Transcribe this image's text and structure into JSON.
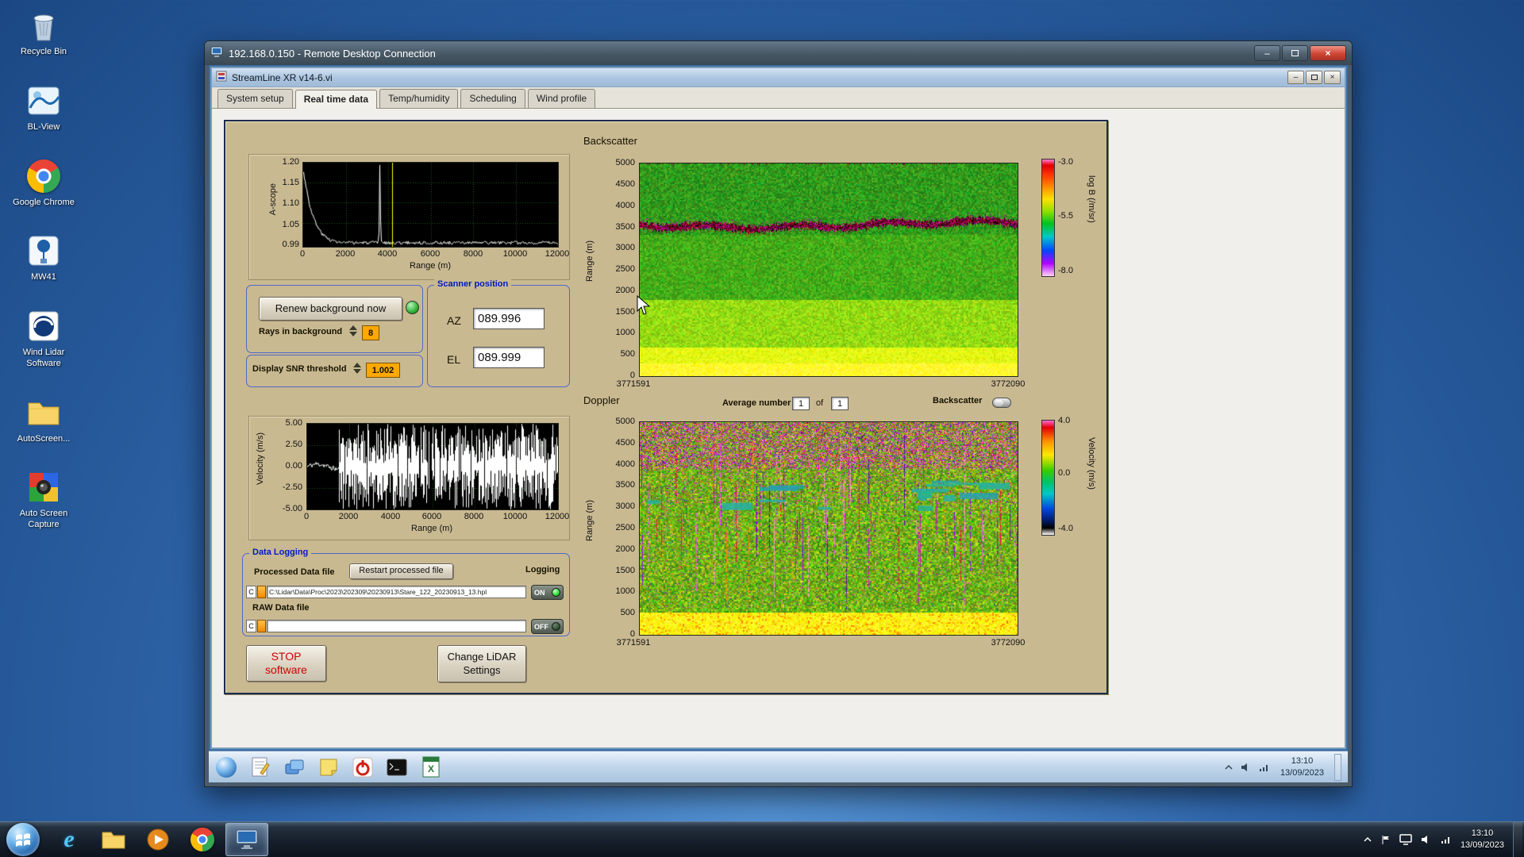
{
  "desktop": {
    "icons": [
      {
        "name": "recycle-bin",
        "label": "Recycle Bin"
      },
      {
        "name": "bl-view",
        "label": "BL-View"
      },
      {
        "name": "google-chrome",
        "label": "Google Chrome"
      },
      {
        "name": "mw41",
        "label": "MW41"
      },
      {
        "name": "wind-lidar-software",
        "label": "Wind Lidar Software"
      },
      {
        "name": "autoscreen-folder",
        "label": "AutoScreen..."
      },
      {
        "name": "auto-screen-capture",
        "label": "Auto Screen Capture"
      }
    ]
  },
  "rdp_window": {
    "title": "192.168.0.150 - Remote Desktop Connection"
  },
  "app_window": {
    "title": "StreamLine XR v14-6.vi",
    "tabs": [
      {
        "label": "System setup"
      },
      {
        "label": "Real time data"
      },
      {
        "label": "Temp/humidity"
      },
      {
        "label": "Scheduling"
      },
      {
        "label": "Wind profile"
      }
    ],
    "active_tab": "Real time data"
  },
  "panel": {
    "ascope": {
      "ylabel": "A-scope",
      "xlabel": "Range (m)",
      "yticks": [
        "1.20",
        "1.15",
        "1.10",
        "1.05",
        "0.99"
      ],
      "xticks": [
        "0",
        "2000",
        "4000",
        "6000",
        "8000",
        "10000",
        "12000"
      ]
    },
    "background_controls": {
      "renew_button": "Renew background now",
      "rays_label": "Rays in background",
      "rays_value": "8",
      "snr_label": "Display SNR threshold",
      "snr_value": "1.002"
    },
    "scanner": {
      "title": "Scanner position",
      "az_label": "AZ",
      "az_value": "089.996",
      "el_label": "EL",
      "el_value": "089.999"
    },
    "velocity": {
      "ylabel": "Velocity (m/s)",
      "xlabel": "Range (m)",
      "yticks": [
        "5.00",
        "2.50",
        "0.00",
        "-2.50",
        "-5.00"
      ],
      "xticks": [
        "0",
        "2000",
        "4000",
        "6000",
        "8000",
        "10000",
        "12000"
      ]
    },
    "backscatter": {
      "title": "Backscatter",
      "ylabel": "Range (m)",
      "yticks": [
        "5000",
        "4500",
        "4000",
        "3500",
        "3000",
        "2500",
        "2000",
        "1500",
        "1000",
        "500",
        "0"
      ],
      "x_start": "3771591",
      "x_end": "3772090",
      "colorbar_label": "log B (/m/sr)",
      "colorbar_ticks": [
        "-3.0",
        "-5.5",
        "-8.0"
      ]
    },
    "doppler": {
      "title": "Doppler",
      "average_label": "Average number",
      "average_value": "1",
      "of_label": "of",
      "average_total": "1",
      "backscatter_toggle_label": "Backscatter",
      "ylabel": "Range (m)",
      "yticks": [
        "5000",
        "4500",
        "4000",
        "3500",
        "3000",
        "2500",
        "2000",
        "1500",
        "1000",
        "500",
        "0"
      ],
      "x_start": "3771591",
      "x_end": "3772090",
      "colorbar_label": "Velocity (m/s)",
      "colorbar_ticks": [
        "4.0",
        "0.0",
        "-4.0"
      ]
    },
    "data_logging": {
      "title": "Data Logging",
      "processed_label": "Processed Data file",
      "restart_button": "Restart processed file",
      "logging_label": "Logging",
      "drive_letter": "C",
      "processed_path": "C:\\Lidar\\Data\\Proc\\2023\\202309\\20230913\\Stare_122_20230913_13.hpl",
      "processed_state": "ON",
      "raw_label": "RAW Data file",
      "raw_path": "",
      "raw_state": "OFF"
    },
    "stop_button_line1": "STOP",
    "stop_button_line2": "software",
    "change_button_line1": "Change LiDAR",
    "change_button_line2": "Settings"
  },
  "remote_taskbar": {
    "time": "13:10",
    "date": "13/09/2023",
    "icons": [
      "browser",
      "notepad",
      "remote-app",
      "sticky-note",
      "power",
      "command-prompt",
      "spreadsheet"
    ],
    "tray_icons": [
      "hidden-icons-arrow",
      "volume",
      "network"
    ]
  },
  "host_taskbar": {
    "time": "13:10",
    "date": "13/09/2023",
    "icons": [
      "start-orb",
      "internet-explorer",
      "file-explorer",
      "media-player",
      "chrome",
      "remote-desktop"
    ],
    "tray_icons": [
      "hidden-icons-arrow",
      "flag",
      "monitor",
      "volume",
      "network"
    ]
  },
  "chart_data": [
    {
      "id": "ascope",
      "type": "line",
      "ylabel": "A-scope",
      "xlabel": "Range (m)",
      "xlim": [
        0,
        12000
      ],
      "ylim": [
        0.99,
        1.2
      ],
      "xticks": [
        0,
        2000,
        4000,
        6000,
        8000,
        10000,
        12000
      ],
      "yticks": [
        1.2,
        1.15,
        1.1,
        1.05,
        0.99
      ],
      "series": [
        {
          "name": "A-scope background",
          "x": [
            0,
            120,
            300,
            600,
            900,
            1300,
            1800,
            2500,
            3200,
            3500,
            3560,
            3600,
            3650,
            3720,
            4000,
            5000,
            6000,
            7000,
            8000,
            9000,
            10000,
            11000,
            12000
          ],
          "y": [
            1.175,
            1.14,
            1.09,
            1.045,
            1.02,
            1.006,
            1.0,
            1.0,
            1.0,
            1.0,
            1.01,
            1.195,
            1.01,
            1.0,
            1.0,
            1.0,
            1.0,
            1.0,
            1.0,
            1.0,
            1.0,
            1.0,
            1.0
          ]
        }
      ],
      "cursor_x": 4200,
      "bg": "#000000",
      "grid_color": "#1d5c1d",
      "line_color": "#ffffff",
      "cursor_color": "#ffff00"
    },
    {
      "id": "velocity",
      "type": "line",
      "ylabel": "Velocity (m/s)",
      "xlabel": "Range (m)",
      "xlim": [
        0,
        12000
      ],
      "ylim": [
        -5,
        5
      ],
      "xticks": [
        0,
        2000,
        4000,
        6000,
        8000,
        10000,
        12000
      ],
      "yticks": [
        5.0,
        2.5,
        0.0,
        -2.5,
        -5.0
      ],
      "noise_start_x": 1500,
      "description": "Radial velocity near 0 m/s out to ~1500 m, then uncorrelated noise spanning the full -5 to +5 m/s range out to 12000 m",
      "bg": "#000000",
      "grid_color": "#1d5c1d",
      "line_color": "#ffffff"
    },
    {
      "id": "backscatter",
      "type": "heatmap",
      "title": "Backscatter",
      "ylabel": "Range (m)",
      "ylim": [
        0,
        5000
      ],
      "yticks": [
        5000,
        4500,
        4000,
        3500,
        3000,
        2500,
        2000,
        1500,
        1000,
        500,
        0
      ],
      "x_range": [
        3771591,
        3772090
      ],
      "colorbar": {
        "label": "log B (/m/sr)",
        "ticks": [
          -3.0,
          -5.5,
          -8.0
        ]
      },
      "features": {
        "background_level_logB": -5.5,
        "aerosol_gradient_below_m": 1800,
        "surface_layer_yellow_below_m": 700,
        "cloud_layer_m": [
          3400,
          3700
        ],
        "cloud_level_logB": -3.0
      }
    },
    {
      "id": "doppler",
      "type": "heatmap",
      "title": "Doppler",
      "ylabel": "Range (m)",
      "ylim": [
        0,
        5000
      ],
      "yticks": [
        5000,
        4500,
        4000,
        3500,
        3000,
        2500,
        2000,
        1500,
        1000,
        500,
        0
      ],
      "x_range": [
        3771591,
        3772090
      ],
      "colorbar": {
        "label": "Velocity (m/s)",
        "ticks": [
          4.0,
          0.0,
          -4.0
        ]
      },
      "features": {
        "background_velocity_ms": 0,
        "noise_speckle_above_m": 3800,
        "surface_layer_below_m": 600
      }
    }
  ]
}
